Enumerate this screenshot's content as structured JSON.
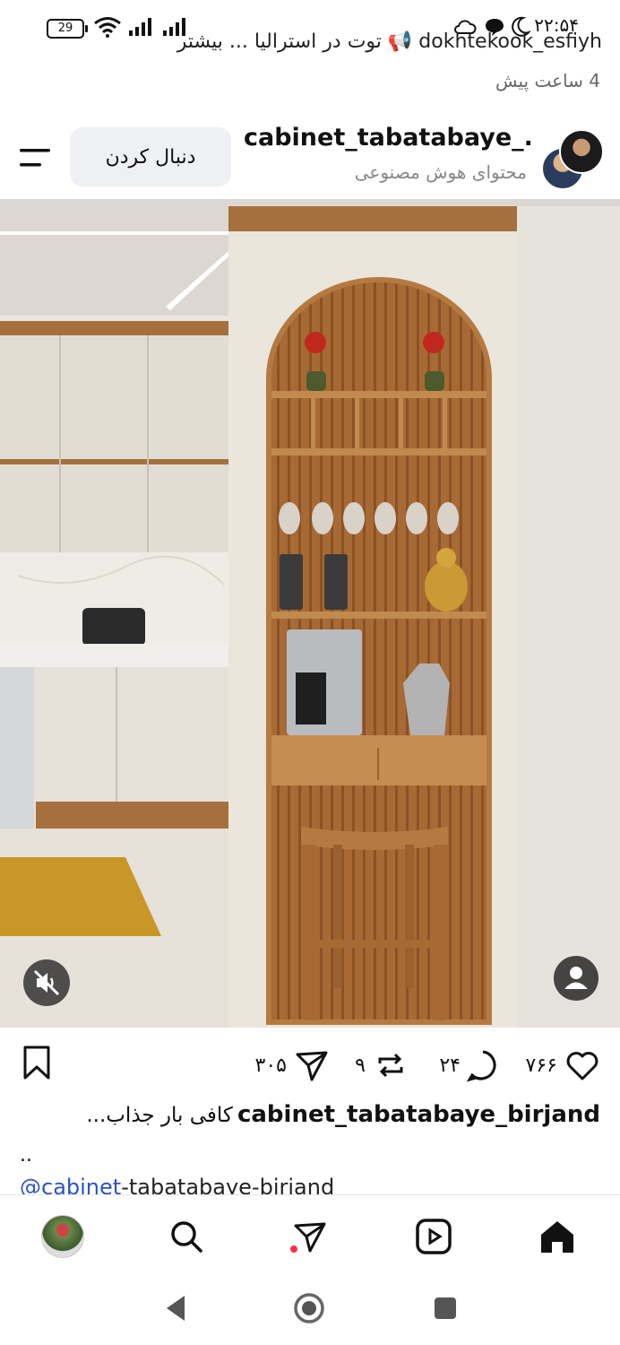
{
  "status_bar": {
    "battery": "29",
    "time": "۲۲:۵۴"
  },
  "previous_post": {
    "caption_fragment": "dokhtekook_esfiyh 📢 توت در استرالیا ... بیشتر",
    "time": "4 ساعت پیش"
  },
  "post": {
    "username": "cabinet_tabatabaye_...",
    "subtitle": "محتوای هوش مصنوعی",
    "follow_label": "دنبال کردن",
    "likes": "۷۶۶",
    "comments": "۲۴",
    "reposts": "۹",
    "shares": "۳۰۵",
    "caption_user": "cabinet_tabatabaye_birjand",
    "caption_text": "کافی بار جذاب...",
    "caption_dots": "..",
    "mention_tag": "@cabinet",
    "mention_rest": "-tabatabaye-birjand"
  },
  "icons": {
    "menu": "menu-icon",
    "like": "heart-icon",
    "comment": "comment-icon",
    "repost": "repost-icon",
    "share": "send-icon",
    "save": "bookmark-icon",
    "mute": "speaker-muted-icon",
    "user_tag": "person-icon"
  },
  "colors": {
    "accent_link": "#2b53c8",
    "notification_dot": "#ff2d4b",
    "follow_button_bg": "#eef0f4"
  }
}
